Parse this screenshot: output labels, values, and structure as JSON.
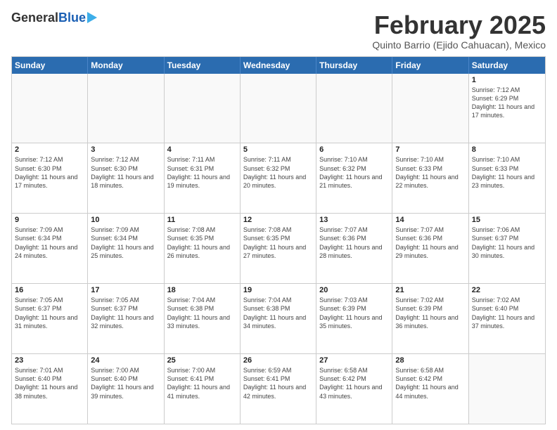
{
  "header": {
    "logo_general": "General",
    "logo_blue": "Blue",
    "month_title": "February 2025",
    "subtitle": "Quinto Barrio (Ejido Cahuacan), Mexico"
  },
  "days_of_week": [
    "Sunday",
    "Monday",
    "Tuesday",
    "Wednesday",
    "Thursday",
    "Friday",
    "Saturday"
  ],
  "weeks": [
    [
      {
        "day": "",
        "info": ""
      },
      {
        "day": "",
        "info": ""
      },
      {
        "day": "",
        "info": ""
      },
      {
        "day": "",
        "info": ""
      },
      {
        "day": "",
        "info": ""
      },
      {
        "day": "",
        "info": ""
      },
      {
        "day": "1",
        "info": "Sunrise: 7:12 AM\nSunset: 6:29 PM\nDaylight: 11 hours and 17 minutes."
      }
    ],
    [
      {
        "day": "2",
        "info": "Sunrise: 7:12 AM\nSunset: 6:30 PM\nDaylight: 11 hours and 17 minutes."
      },
      {
        "day": "3",
        "info": "Sunrise: 7:12 AM\nSunset: 6:30 PM\nDaylight: 11 hours and 18 minutes."
      },
      {
        "day": "4",
        "info": "Sunrise: 7:11 AM\nSunset: 6:31 PM\nDaylight: 11 hours and 19 minutes."
      },
      {
        "day": "5",
        "info": "Sunrise: 7:11 AM\nSunset: 6:32 PM\nDaylight: 11 hours and 20 minutes."
      },
      {
        "day": "6",
        "info": "Sunrise: 7:10 AM\nSunset: 6:32 PM\nDaylight: 11 hours and 21 minutes."
      },
      {
        "day": "7",
        "info": "Sunrise: 7:10 AM\nSunset: 6:33 PM\nDaylight: 11 hours and 22 minutes."
      },
      {
        "day": "8",
        "info": "Sunrise: 7:10 AM\nSunset: 6:33 PM\nDaylight: 11 hours and 23 minutes."
      }
    ],
    [
      {
        "day": "9",
        "info": "Sunrise: 7:09 AM\nSunset: 6:34 PM\nDaylight: 11 hours and 24 minutes."
      },
      {
        "day": "10",
        "info": "Sunrise: 7:09 AM\nSunset: 6:34 PM\nDaylight: 11 hours and 25 minutes."
      },
      {
        "day": "11",
        "info": "Sunrise: 7:08 AM\nSunset: 6:35 PM\nDaylight: 11 hours and 26 minutes."
      },
      {
        "day": "12",
        "info": "Sunrise: 7:08 AM\nSunset: 6:35 PM\nDaylight: 11 hours and 27 minutes."
      },
      {
        "day": "13",
        "info": "Sunrise: 7:07 AM\nSunset: 6:36 PM\nDaylight: 11 hours and 28 minutes."
      },
      {
        "day": "14",
        "info": "Sunrise: 7:07 AM\nSunset: 6:36 PM\nDaylight: 11 hours and 29 minutes."
      },
      {
        "day": "15",
        "info": "Sunrise: 7:06 AM\nSunset: 6:37 PM\nDaylight: 11 hours and 30 minutes."
      }
    ],
    [
      {
        "day": "16",
        "info": "Sunrise: 7:05 AM\nSunset: 6:37 PM\nDaylight: 11 hours and 31 minutes."
      },
      {
        "day": "17",
        "info": "Sunrise: 7:05 AM\nSunset: 6:37 PM\nDaylight: 11 hours and 32 minutes."
      },
      {
        "day": "18",
        "info": "Sunrise: 7:04 AM\nSunset: 6:38 PM\nDaylight: 11 hours and 33 minutes."
      },
      {
        "day": "19",
        "info": "Sunrise: 7:04 AM\nSunset: 6:38 PM\nDaylight: 11 hours and 34 minutes."
      },
      {
        "day": "20",
        "info": "Sunrise: 7:03 AM\nSunset: 6:39 PM\nDaylight: 11 hours and 35 minutes."
      },
      {
        "day": "21",
        "info": "Sunrise: 7:02 AM\nSunset: 6:39 PM\nDaylight: 11 hours and 36 minutes."
      },
      {
        "day": "22",
        "info": "Sunrise: 7:02 AM\nSunset: 6:40 PM\nDaylight: 11 hours and 37 minutes."
      }
    ],
    [
      {
        "day": "23",
        "info": "Sunrise: 7:01 AM\nSunset: 6:40 PM\nDaylight: 11 hours and 38 minutes."
      },
      {
        "day": "24",
        "info": "Sunrise: 7:00 AM\nSunset: 6:40 PM\nDaylight: 11 hours and 39 minutes."
      },
      {
        "day": "25",
        "info": "Sunrise: 7:00 AM\nSunset: 6:41 PM\nDaylight: 11 hours and 41 minutes."
      },
      {
        "day": "26",
        "info": "Sunrise: 6:59 AM\nSunset: 6:41 PM\nDaylight: 11 hours and 42 minutes."
      },
      {
        "day": "27",
        "info": "Sunrise: 6:58 AM\nSunset: 6:42 PM\nDaylight: 11 hours and 43 minutes."
      },
      {
        "day": "28",
        "info": "Sunrise: 6:58 AM\nSunset: 6:42 PM\nDaylight: 11 hours and 44 minutes."
      },
      {
        "day": "",
        "info": ""
      }
    ]
  ]
}
